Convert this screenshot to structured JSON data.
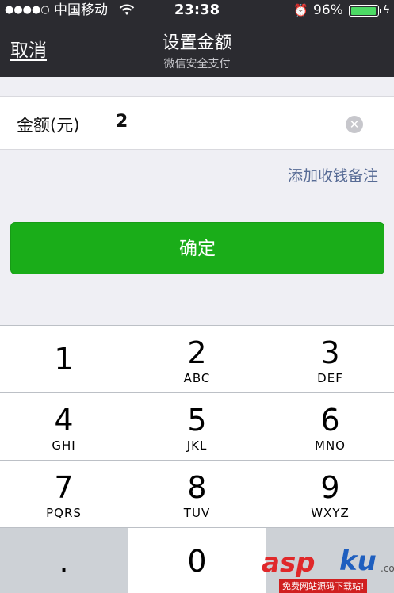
{
  "status_bar": {
    "signal": "●●●●○",
    "carrier": "中国移动",
    "time": "23:38",
    "battery_percent": "96%",
    "battery_level": 0.96
  },
  "nav": {
    "cancel_label": "取消",
    "title": "设置金额",
    "subtitle": "微信安全支付"
  },
  "form": {
    "amount_label": "金额(元)",
    "amount_value": "2",
    "remark_link": "添加收钱备注",
    "confirm_label": "确定"
  },
  "keypad": {
    "keys": [
      {
        "num": "1",
        "letters": ""
      },
      {
        "num": "2",
        "letters": "ABC"
      },
      {
        "num": "3",
        "letters": "DEF"
      },
      {
        "num": "4",
        "letters": "GHI"
      },
      {
        "num": "5",
        "letters": "JKL"
      },
      {
        "num": "6",
        "letters": "MNO"
      },
      {
        "num": "7",
        "letters": "PQRS"
      },
      {
        "num": "8",
        "letters": "TUV"
      },
      {
        "num": "9",
        "letters": "WXYZ"
      },
      {
        "num": ".",
        "letters": ""
      },
      {
        "num": "0",
        "letters": ""
      }
    ]
  },
  "watermark": {
    "brand_a": "asp",
    "brand_b": "ku",
    "suffix": ".com",
    "tagline": "免费网站源码下载站!"
  },
  "colors": {
    "nav_bg": "#2b2b30",
    "accent_green": "#1aad19",
    "link_blue": "#576b95",
    "battery_green": "#4cd964"
  }
}
